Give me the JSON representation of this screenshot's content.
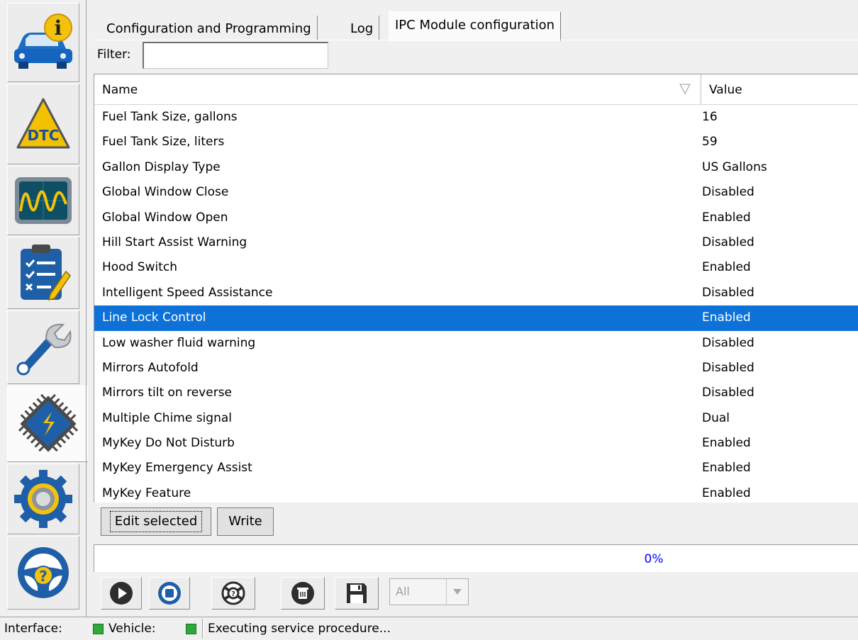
{
  "sidebar": {
    "items": [
      {
        "name": "vehicle-info",
        "active": false
      },
      {
        "name": "dtc",
        "label": "DTC",
        "active": false
      },
      {
        "name": "oscilloscope",
        "active": false
      },
      {
        "name": "checklist",
        "active": false
      },
      {
        "name": "service",
        "active": false
      },
      {
        "name": "module-config",
        "active": true
      },
      {
        "name": "settings",
        "active": false
      },
      {
        "name": "help",
        "active": false
      }
    ]
  },
  "tabs": [
    {
      "label": "Configuration and Programming",
      "active": false
    },
    {
      "label": "Log",
      "active": false
    },
    {
      "label": "IPC Module configuration",
      "active": true
    }
  ],
  "filter": {
    "label": "Filter:",
    "value": ""
  },
  "table": {
    "columns": [
      "Name",
      "Value"
    ],
    "selected_index": 8,
    "rows": [
      {
        "name": "Fuel Tank Size, gallons",
        "value": "16"
      },
      {
        "name": "Fuel Tank Size, liters",
        "value": "59"
      },
      {
        "name": "Gallon Display Type",
        "value": "US Gallons"
      },
      {
        "name": "Global Window Close",
        "value": "Disabled"
      },
      {
        "name": "Global Window Open",
        "value": "Enabled"
      },
      {
        "name": "Hill Start Assist Warning",
        "value": "Disabled"
      },
      {
        "name": "Hood Switch",
        "value": "Enabled"
      },
      {
        "name": "Intelligent Speed Assistance",
        "value": "Disabled"
      },
      {
        "name": "Line Lock Control",
        "value": "Enabled"
      },
      {
        "name": "Low washer fluid warning",
        "value": "Disabled"
      },
      {
        "name": "Mirrors Autofold",
        "value": "Disabled"
      },
      {
        "name": "Mirrors tilt on reverse",
        "value": "Disabled"
      },
      {
        "name": "Multiple Chime signal",
        "value": "Dual"
      },
      {
        "name": "MyKey Do Not Disturb",
        "value": "Enabled"
      },
      {
        "name": "MyKey Emergency Assist",
        "value": "Enabled"
      },
      {
        "name": "MyKey Feature",
        "value": "Enabled"
      }
    ]
  },
  "buttons": {
    "edit_selected": "Edit selected",
    "write": "Write"
  },
  "progress": {
    "percent": 0,
    "text": "0%"
  },
  "toolbar": {
    "icons": [
      "play-icon",
      "stop-icon",
      "lifebuoy-icon",
      "clear-icon",
      "save-icon"
    ],
    "combo_value": "All"
  },
  "status": {
    "interface_label": "Interface:",
    "vehicle_label": "Vehicle:",
    "message": "Executing service procedure..."
  },
  "colors": {
    "selection": "#0d71d8",
    "status_ok": "#2faa3a",
    "progress_text": "#0000ff"
  }
}
